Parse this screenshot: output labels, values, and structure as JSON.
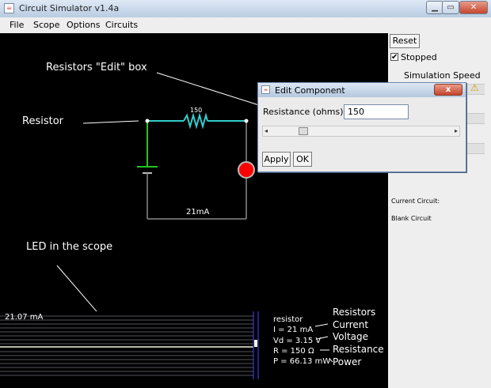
{
  "window": {
    "title": "Circuit Simulator v1.4a"
  },
  "menu": [
    "File",
    "Scope",
    "Options",
    "Circuits"
  ],
  "panel": {
    "reset_label": "Reset",
    "stopped_label": "Stopped",
    "sim_speed_label": "Simulation Speed",
    "current_circuit_label": "Current Circuit:",
    "circuit_name": "Blank Circuit"
  },
  "annotations": {
    "edit_box": "Resistors \"Edit\" box",
    "resistor": "Resistor",
    "led_scope": "LED in the scope",
    "resistors": "Resistors",
    "current": "Current",
    "voltage": "Voltage",
    "resistance": "Resistance",
    "power": "Power"
  },
  "circuit": {
    "resistor_value": "150",
    "current_label": "21mA"
  },
  "scope": {
    "max_label": "21.07 mA",
    "info_title": "resistor",
    "info_current": "I = 21 mA",
    "info_voltage": "Vd = 3.15 V",
    "info_resistance": "R = 150 Ω",
    "info_power": "P = 66.13 mW"
  },
  "dialog": {
    "title": "Edit Component",
    "close_label": "x",
    "field_label": "Resistance (ohms)",
    "field_value": "150",
    "apply_label": "Apply",
    "ok_label": "OK"
  },
  "colors": {
    "wire": "#33cccc",
    "led": "#ff0000",
    "battery_green": "#22c422",
    "annotation_text": "#ffffff"
  }
}
